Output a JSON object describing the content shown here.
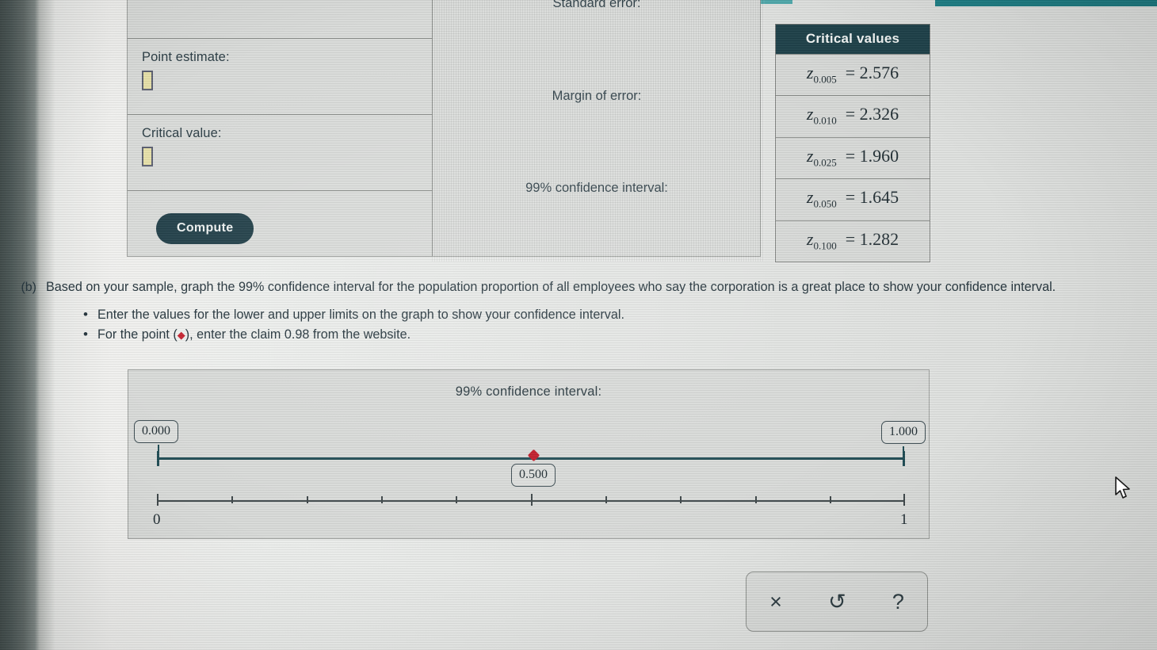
{
  "calculator": {
    "dropdown_icon": "chevron-down-icon",
    "point_estimate_label": "Point estimate:",
    "point_estimate_value": "",
    "critical_value_label": "Critical value:",
    "critical_value_value": "",
    "compute_label": "Compute",
    "standard_error_label": "Standard error:",
    "margin_of_error_label": "Margin of error:",
    "confidence_interval_label": "99% confidence interval:"
  },
  "critical_values": {
    "header": "Critical values",
    "rows": [
      {
        "sub": "0.005",
        "value": "2.576"
      },
      {
        "sub": "0.010",
        "value": "2.326"
      },
      {
        "sub": "0.025",
        "value": "1.960"
      },
      {
        "sub": "0.050",
        "value": "1.645"
      },
      {
        "sub": "0.100",
        "value": "1.282"
      }
    ]
  },
  "question": {
    "letter": "(b)",
    "text": "Based on your sample, graph the 99% confidence interval for the population proportion of all employees who say the corporation is a great place to show your confidence interval.",
    "bullet_1": "Enter the values for the lower and upper limits on the graph to show your confidence interval.",
    "bullet_2_before": "For the point (",
    "bullet_2_marker": "◆",
    "bullet_2_after": "), enter the claim 0.98 from the website."
  },
  "graph": {
    "title": "99% confidence interval:",
    "lower_limit_value": "0.000",
    "upper_limit_value": "1.000",
    "point_value": "0.500",
    "axis_start_label": "0",
    "axis_end_label": "1",
    "point_marker_color": "#c01826",
    "interval_color": "#1d4a52"
  },
  "toolbar": {
    "clear_label": "×",
    "undo_label": "↺",
    "help_label": "?"
  },
  "chart_data": {
    "type": "line",
    "title": "99% confidence interval:",
    "xlabel": "",
    "ylabel": "",
    "xlim": [
      0,
      1
    ],
    "grid": false,
    "legend": "none",
    "tick_values": [
      0,
      0.1,
      0.2,
      0.3,
      0.4,
      0.5,
      0.6,
      0.7,
      0.8,
      0.9,
      1
    ],
    "tick_labels": [
      "0",
      "",
      "",
      "",
      "",
      "",
      "",
      "",
      "",
      "",
      "1"
    ],
    "series": [
      {
        "name": "confidence interval",
        "type": "interval",
        "lower": 0.0,
        "upper": 1.0,
        "color": "#1d4a52"
      },
      {
        "name": "claim point",
        "type": "point",
        "x": 0.5,
        "color": "#c01826"
      }
    ],
    "annotations": [
      {
        "text": "0.000",
        "x": 0.0,
        "position": "above-left"
      },
      {
        "text": "1.000",
        "x": 1.0,
        "position": "above-right"
      },
      {
        "text": "0.500",
        "x": 0.5,
        "position": "below"
      }
    ]
  },
  "colors": {
    "accent_dark_teal": "#1d4049",
    "compute_button": "#1f3d47",
    "chevron_teal": "#2c8e96",
    "chevron_bg": "#bcd9de",
    "input_yellow": "#e6e0a8",
    "marker_red": "#c01826",
    "panel_bg": "#d8dad8",
    "page_bg": "#eceeec"
  }
}
